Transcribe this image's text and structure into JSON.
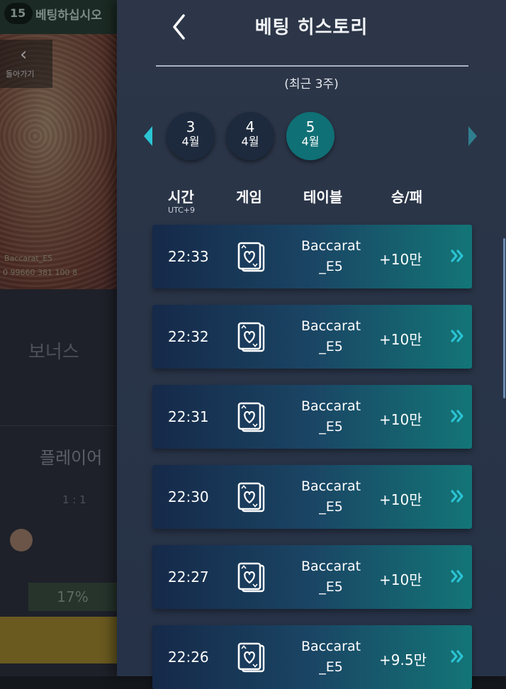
{
  "background": {
    "round": "15",
    "title": "베팅하십시오",
    "back_label": "돌아가기",
    "table_name": "Baccarat_E5",
    "table_stats": "0 99660 381 100 8",
    "bonus": "보너스",
    "player": "플레이어",
    "ratio": "1 : 1",
    "percent": "17%"
  },
  "history": {
    "title": "베팅 히스토리",
    "subtitle": "(최근 3주)",
    "weeks": [
      {
        "num": "3",
        "month": "4월",
        "active": false
      },
      {
        "num": "4",
        "month": "4월",
        "active": false
      },
      {
        "num": "5",
        "month": "4월",
        "active": true
      }
    ],
    "columns": {
      "time": "시간",
      "timezone": "UTC+9",
      "game": "게임",
      "table": "테이블",
      "result": "승/패"
    },
    "rows": [
      {
        "time": "22:33",
        "table": "Baccarat\n_E5",
        "result": "+10만"
      },
      {
        "time": "22:32",
        "table": "Baccarat\n_E5",
        "result": "+10만"
      },
      {
        "time": "22:31",
        "table": "Baccarat\n_E5",
        "result": "+10만"
      },
      {
        "time": "22:30",
        "table": "Baccarat\n_E5",
        "result": "+10만"
      },
      {
        "time": "22:27",
        "table": "Baccarat\n_E5",
        "result": "+10만"
      },
      {
        "time": "22:26",
        "table": "Baccarat\n_E5",
        "result": "+9.5만"
      }
    ]
  },
  "icons": {
    "back": "chevron-left-icon",
    "prev_week": "triangle-left-icon",
    "next_week": "triangle-right-icon",
    "game": "playing-card-heart-icon",
    "row_detail": "double-chevron-right-icon"
  },
  "colors": {
    "panel": "#2c3648",
    "active_week": "#0f7075",
    "accent": "#2bc4d4"
  }
}
